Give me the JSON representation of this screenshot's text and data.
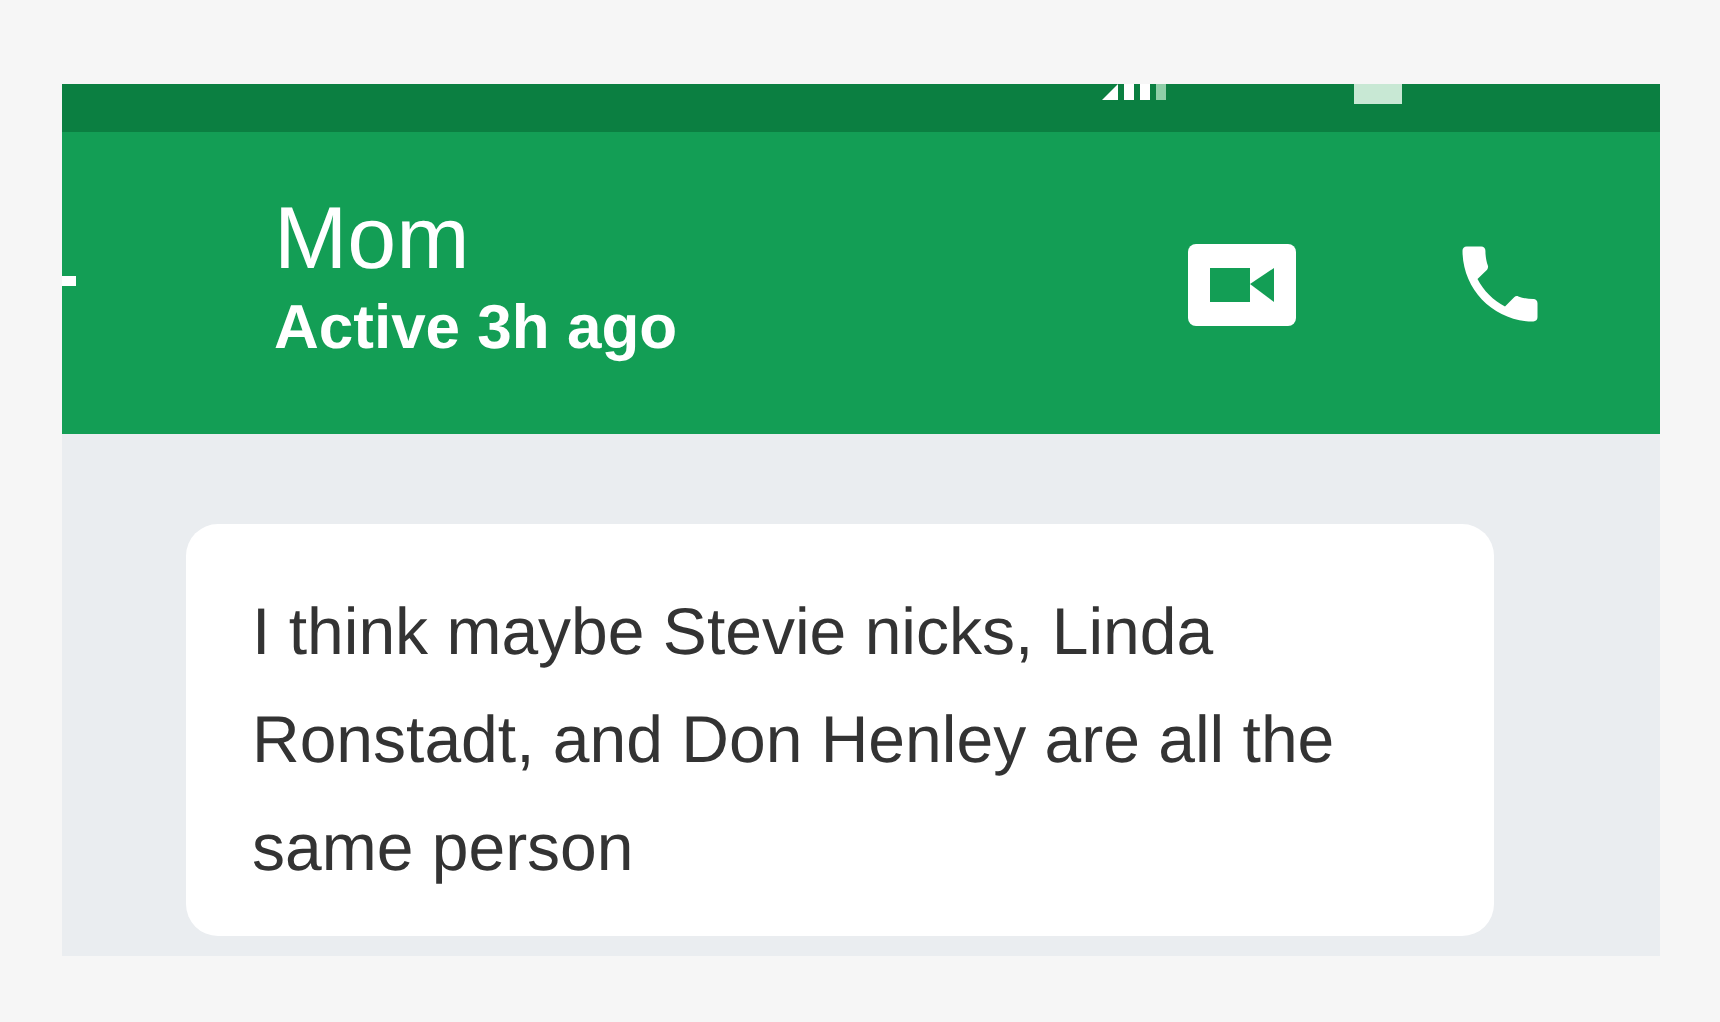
{
  "header": {
    "title": "Mom",
    "subtitle": "Active 3h ago"
  },
  "messages": [
    {
      "text": "I think maybe Stevie nicks, Linda Ronstadt, and Don Henley are all the same person"
    }
  ]
}
